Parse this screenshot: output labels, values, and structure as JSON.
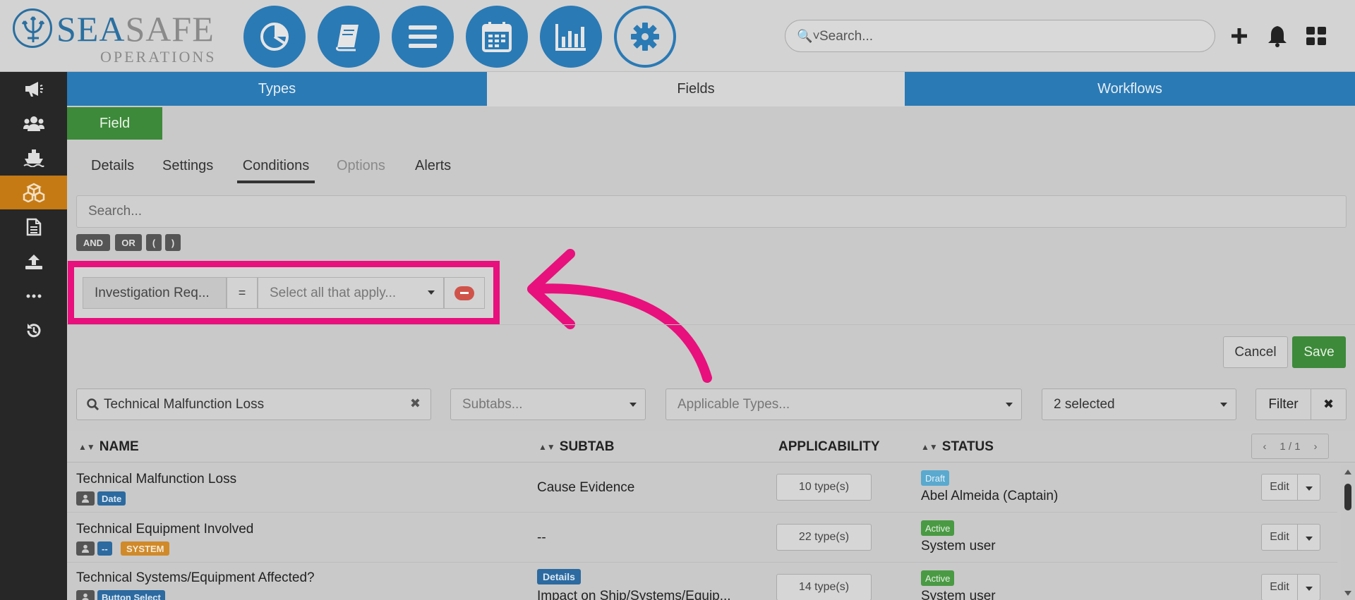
{
  "brand": {
    "name_part1": "SEA",
    "name_part2": "SAFE",
    "subtitle": "OPERATIONS"
  },
  "header": {
    "nav_icons": [
      "pie-chart-icon",
      "book-icon",
      "menu-icon",
      "calendar-icon",
      "bar-chart-icon",
      "gear-icon"
    ],
    "search_placeholder": "Search...",
    "colors": {
      "accent": "#2a7ab5",
      "highlight": "#e8107c",
      "save": "#3d8a3a",
      "sidebar_active": "#c57a14"
    }
  },
  "sidebar": {
    "items": [
      "megaphone-icon",
      "users-icon",
      "ship-icon",
      "cubes-icon",
      "document-icon",
      "upload-icon",
      "more-icon",
      "history-icon"
    ],
    "active_index": 3
  },
  "main_tabs": [
    {
      "label": "Types"
    },
    {
      "label": "Fields"
    },
    {
      "label": "Workflows"
    }
  ],
  "field_button": "Field",
  "sub_tabs": [
    {
      "label": "Details"
    },
    {
      "label": "Settings"
    },
    {
      "label": "Conditions"
    },
    {
      "label": "Options"
    },
    {
      "label": "Alerts"
    }
  ],
  "conditions": {
    "search_placeholder": "Search...",
    "operators": [
      "AND",
      "OR",
      "(",
      ")"
    ],
    "rule": {
      "field": "Investigation Req...",
      "operator": "=",
      "value_placeholder": "Select all that apply..."
    }
  },
  "actions": {
    "cancel": "Cancel",
    "save": "Save"
  },
  "filters": {
    "search_value": "Technical Malfunction Loss",
    "subtabs_placeholder": "Subtabs...",
    "types_placeholder": "Applicable Types...",
    "status_value": "2 selected",
    "filter_button": "Filter"
  },
  "table": {
    "headers": {
      "name": "NAME",
      "subtab": "SUBTAB",
      "applicability": "APPLICABILITY",
      "status": "STATUS"
    },
    "pager": {
      "prev": "‹",
      "page": "1 / 1",
      "next": "›"
    },
    "rows": [
      {
        "name": "Technical Malfunction Loss",
        "tags": [
          "Date"
        ],
        "subtab": "Cause Evidence",
        "applicability": "10 type(s)",
        "status": "Draft",
        "status_user": "Abel Almeida (Captain)",
        "edit": "Edit"
      },
      {
        "name": "Technical Equipment Involved",
        "tags": [
          "--",
          "SYSTEM"
        ],
        "subtab": "--",
        "applicability": "22 type(s)",
        "status": "Active",
        "status_user": "System user",
        "edit": "Edit"
      },
      {
        "name": "Technical Systems/Equipment Affected?",
        "tags": [
          "Button Select"
        ],
        "subtab_chip": "Details",
        "subtab": "Impact on Ship/Systems/Equip...",
        "applicability": "14 type(s)",
        "status": "Active",
        "status_user": "System user",
        "edit": "Edit"
      }
    ]
  }
}
